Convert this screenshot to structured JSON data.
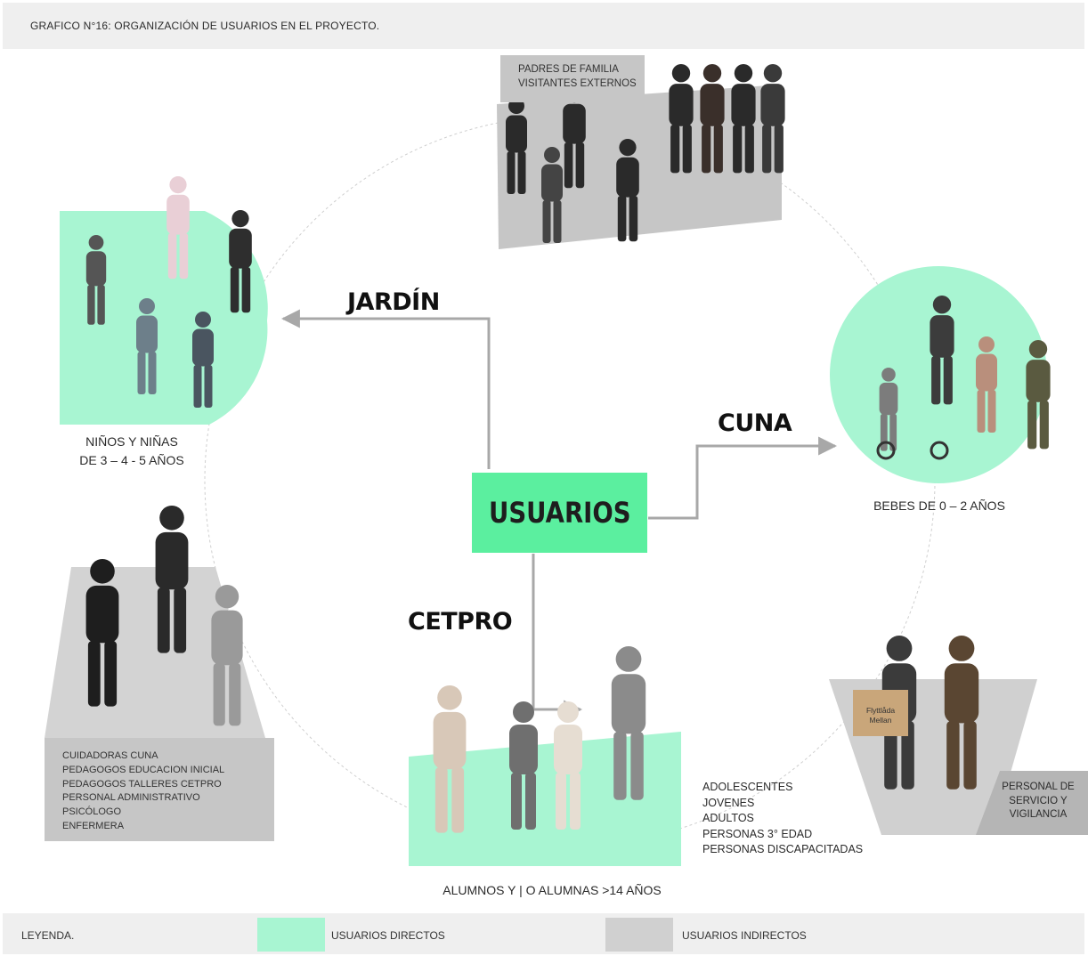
{
  "title": "GRAFICO N°16: ORGANIZACIÓN DE USUARIOS EN EL PROYECTO.",
  "center": {
    "label": "USUARIOS"
  },
  "branches": {
    "jardin": "JARDÍN",
    "cuna": "CUNA",
    "cetpro": "CETPRO"
  },
  "groups": {
    "ninos": {
      "line1": "NIÑOS Y NIÑAS",
      "line2": "DE 3 – 4 - 5 AÑOS",
      "type": "directo"
    },
    "bebes": {
      "label": "BEBES DE 0 – 2 AÑOS",
      "type": "directo"
    },
    "alumnos": {
      "label": "ALUMNOS Y | O ALUMNAS >14 AÑOS",
      "type": "directo",
      "items": [
        "ADOLESCENTES",
        "JOVENES",
        "ADULTOS",
        "PERSONAS 3° EDAD",
        "PERSONAS DISCAPACITADAS"
      ]
    },
    "padres": {
      "line1": "PADRES DE FAMILIA",
      "line2": "VISITANTES EXTERNOS",
      "type": "indirecto"
    },
    "personal": {
      "type": "indirecto",
      "items": [
        "CUIDADORAS CUNA",
        "PEDAGOGOS EDUCACION INICIAL",
        "PEDAGOGOS TALLERES CETPRO",
        "PERSONAL ADMINISTRATIVO",
        "PSICÓLOGO",
        "ENFERMERA"
      ]
    },
    "servicio": {
      "line1": "PERSONAL DE",
      "line2": "SERVICIO Y",
      "line3": "VIGILANCIA",
      "type": "indirecto",
      "box_text_1": "Flyttlåda",
      "box_text_2": "Mellan"
    }
  },
  "legend": {
    "title": "LEYENDA.",
    "direct": "USUARIOS DIRECTOS",
    "indirect": "USUARIOS INDIRECTOS"
  },
  "colors": {
    "center": "#5bef9f",
    "direct": "#a8f5d2",
    "indirect": "#c6c6c6",
    "connector": "#a8a8a8"
  }
}
